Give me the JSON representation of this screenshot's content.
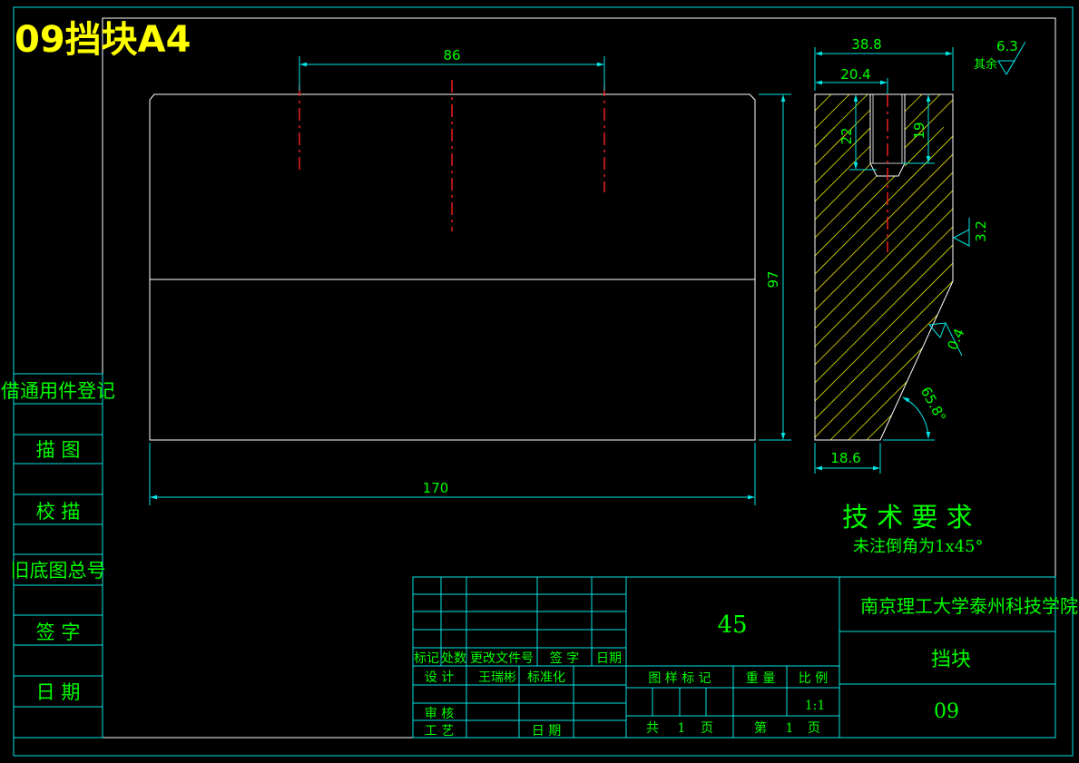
{
  "title": "09挡块A4",
  "colors": {
    "background": "#000000",
    "frame": "#ffffff",
    "dim": "#00e5e5",
    "text": "#00ff00",
    "center": "#ff2020",
    "hatch": "#ffff00",
    "title_text": "#ffff00"
  },
  "dimensions": {
    "hole_pitch": "86",
    "height": "97",
    "length": "170",
    "width": "38.8",
    "step_width": "20.4",
    "bore_depth": "22",
    "thread_depth": "19",
    "base_width": "18.6",
    "angle": "65.8°"
  },
  "roughness": {
    "other": "6.3",
    "other_label": "其余",
    "face": "3.2",
    "chamfer": "0.4"
  },
  "tech_requirements": {
    "heading": "技 术 要 求",
    "note": "未注倒角为1x45°"
  },
  "side_register": {
    "items": [
      "借通用件登记",
      "描 图",
      "校 描",
      "旧底图总号",
      "签 字",
      "日 期"
    ]
  },
  "title_block": {
    "material": "45",
    "school": "南京理工大学泰州科技学院",
    "part_name": "挡块",
    "drawing_no": "09",
    "scale": "1:1",
    "revision_headers": {
      "mark": "标记",
      "count": "处数",
      "doc_no": "更改文件号",
      "sign": "签 字",
      "date": "日期"
    },
    "design_label": "设 计",
    "designer": "王瑞彬",
    "standardization": "标准化",
    "review_label": "审 核",
    "process_label": "工 艺",
    "date_label": "日 期",
    "stage_mark_label": "图 样 标 记",
    "weight_label": "重 量",
    "scale_label": "比 例",
    "total_label": "共",
    "total_pages": "1",
    "page_unit": "页",
    "sheet_label": "第",
    "sheet_no": "1",
    "sheet_unit": "页"
  }
}
